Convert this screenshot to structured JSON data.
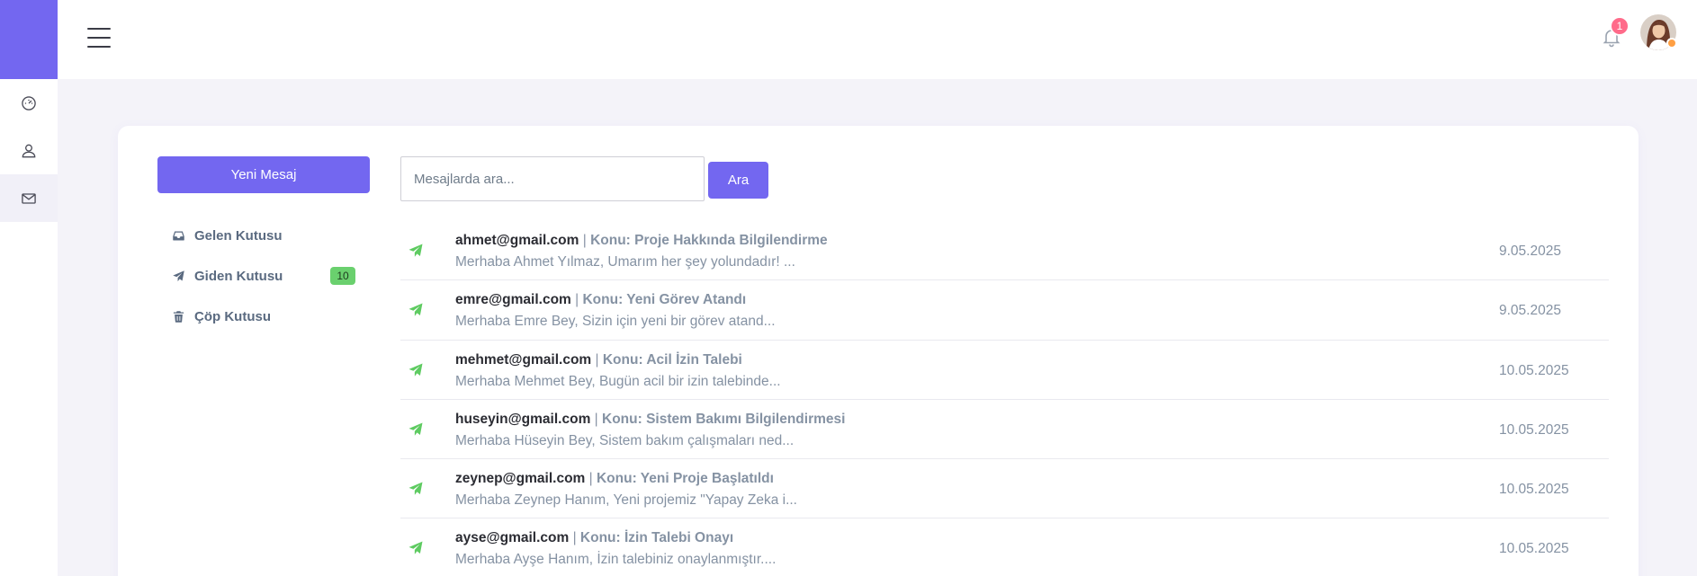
{
  "topbar": {
    "notification_count": "1"
  },
  "compose": {
    "label": "Yeni Mesaj"
  },
  "folders": [
    {
      "label": "Gelen Kutusu",
      "icon": "inbox-icon",
      "count": ""
    },
    {
      "label": "Giden Kutusu",
      "icon": "send-icon",
      "count": "10"
    },
    {
      "label": "Çöp Kutusu",
      "icon": "trash-icon",
      "count": ""
    }
  ],
  "search": {
    "placeholder": "Mesajlarda ara...",
    "button_label": "Ara"
  },
  "messages": [
    {
      "email": "ahmet@gmail.com",
      "separator": " | ",
      "subject": "Konu: Proje Hakkında Bilgilendirme",
      "preview": "Merhaba Ahmet Yılmaz, Umarım her şey yolundadır! ...",
      "date": "9.05.2025"
    },
    {
      "email": "emre@gmail.com",
      "separator": " | ",
      "subject": "Konu: Yeni Görev Atandı",
      "preview": "Merhaba Emre Bey, Sizin için yeni bir görev atand...",
      "date": "9.05.2025"
    },
    {
      "email": "mehmet@gmail.com",
      "separator": " | ",
      "subject": "Konu: Acil İzin Talebi",
      "preview": "Merhaba Mehmet Bey, Bugün acil bir izin talebinde...",
      "date": "10.05.2025"
    },
    {
      "email": "huseyin@gmail.com",
      "separator": " | ",
      "subject": "Konu: Sistem Bakımı Bilgilendirmesi",
      "preview": "Merhaba Hüseyin Bey, Sistem bakım çalışmaları ned...",
      "date": "10.05.2025"
    },
    {
      "email": "zeynep@gmail.com",
      "separator": " | ",
      "subject": "Konu: Yeni Proje Başlatıldı",
      "preview": "Merhaba Zeynep Hanım, Yeni projemiz \"Yapay Zeka i...",
      "date": "10.05.2025"
    },
    {
      "email": "ayse@gmail.com",
      "separator": " | ",
      "subject": "Konu: İzin Talebi Onayı",
      "preview": "Merhaba Ayşe Hanım, İzin talebiniz onaylanmıştır....",
      "date": "10.05.2025"
    }
  ],
  "colors": {
    "accent": "#7367f0",
    "badge_green": "#6ad06e",
    "notification": "#ff6b8a",
    "send_icon": "#5ecb61"
  }
}
